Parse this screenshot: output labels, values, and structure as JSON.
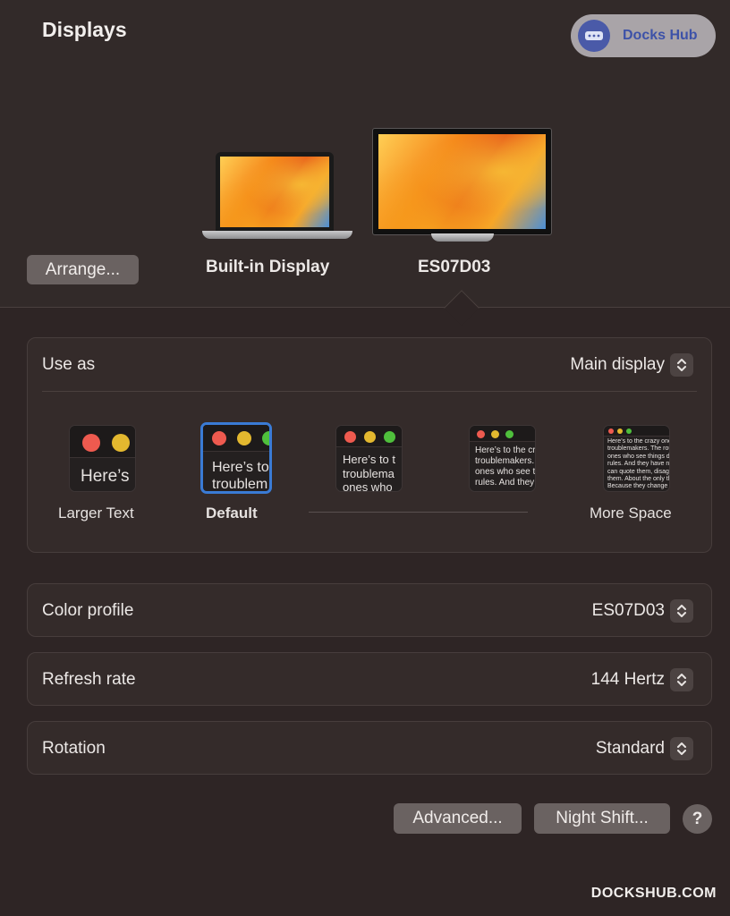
{
  "header": {
    "title": "Displays",
    "brand_badge": "Docks Hub"
  },
  "displays": {
    "arrange_label": "Arrange...",
    "builtin_label": "Built-in Display",
    "external_label": "ES07D03"
  },
  "use_as": {
    "label": "Use as",
    "value": "Main display",
    "resolution_options": [
      {
        "label": "Larger Text",
        "preview": "Here’s",
        "selected": false
      },
      {
        "label": "Default",
        "preview": "Here’s to t\ntroublem",
        "selected": true
      },
      {
        "label": "",
        "preview": "Here’s to t\ntroublema\nones who",
        "selected": false
      },
      {
        "label": "",
        "preview": "Here’s to the cr\ntroublemakers.\nones who see t\nrules. And they",
        "selected": false
      },
      {
        "label": "More Space",
        "preview": "Here’s to the crazy one\ntroublemakers. The rou\nones who see things dif\nrules. And they have no\ncan quote them, disagre\nthem. About the only th\nBecause they change th",
        "selected": false
      }
    ]
  },
  "color_profile": {
    "label": "Color profile",
    "value": "ES07D03"
  },
  "refresh_rate": {
    "label": "Refresh rate",
    "value": "144 Hertz"
  },
  "rotation": {
    "label": "Rotation",
    "value": "Standard"
  },
  "footer": {
    "advanced_label": "Advanced...",
    "night_shift_label": "Night Shift...",
    "help_label": "?"
  },
  "watermark": "DOCKSHUB.COM",
  "colors": {
    "traffic_red": "#ee5a4f",
    "traffic_yellow": "#e3b82f",
    "traffic_green": "#4fbf3c",
    "selection_blue": "#3a7bd5"
  }
}
